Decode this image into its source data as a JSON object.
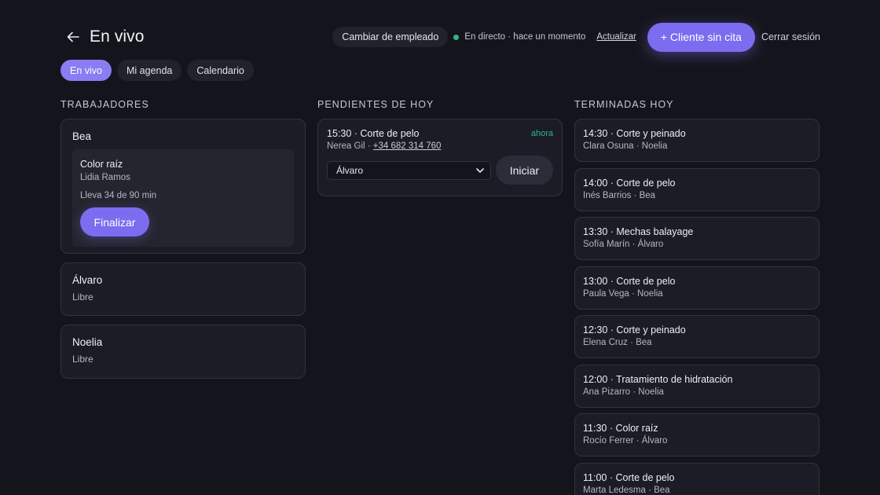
{
  "header": {
    "title": "En vivo",
    "change_employee": "Cambiar de empleado",
    "live_status": "En directo · hace un momento",
    "refresh": "Actualizar",
    "walkin": "+ Cliente sin cita",
    "logout": "Cerrar sesión"
  },
  "tabs": [
    {
      "label": "En vivo",
      "active": true
    },
    {
      "label": "Mi agenda",
      "active": false
    },
    {
      "label": "Calendario",
      "active": false
    }
  ],
  "workers": {
    "title": "TRABAJADORES",
    "items": [
      {
        "name": "Bea",
        "job": {
          "service": "Color raíz",
          "client": "Lidia Ramos",
          "progress": "Lleva 34 de 90 min",
          "finish": "Finalizar"
        }
      },
      {
        "name": "Álvaro",
        "status": "Libre"
      },
      {
        "name": "Noelia",
        "status": "Libre"
      }
    ]
  },
  "pending": {
    "title": "PENDIENTES DE HOY",
    "items": [
      {
        "title": "15:30 · Corte de pelo",
        "when": "ahora",
        "client": "Nerea Gil · ",
        "phone": "+34 682 314 760",
        "assignee": "Álvaro",
        "start": "Iniciar"
      }
    ]
  },
  "done": {
    "title": "TERMINADAS HOY",
    "items": [
      {
        "title": "14:30 · Corte y peinado",
        "sub": "Clara Osuna · Noelia"
      },
      {
        "title": "14:00 · Corte de pelo",
        "sub": "Inés Barrios · Bea"
      },
      {
        "title": "13:30 · Mechas balayage",
        "sub": "Sofía Marín · Álvaro"
      },
      {
        "title": "13:00 · Corte de pelo",
        "sub": "Paula Vega · Noelia"
      },
      {
        "title": "12:30 · Corte y peinado",
        "sub": "Elena Cruz · Bea"
      },
      {
        "title": "12:00 · Tratamiento de hidratación",
        "sub": "Ana Pizarro · Noelia"
      },
      {
        "title": "11:30 · Color raíz",
        "sub": "Rocío Ferrer · Álvaro"
      },
      {
        "title": "11:00 · Corte de pelo",
        "sub": "Marta Ledesma · Bea"
      }
    ]
  },
  "colors": {
    "accent": "#7b6cf0",
    "live": "#2fb58a",
    "background": "#14151c"
  },
  "icons": {
    "back": "arrow-left-icon",
    "select": "chevron-down-icon"
  }
}
